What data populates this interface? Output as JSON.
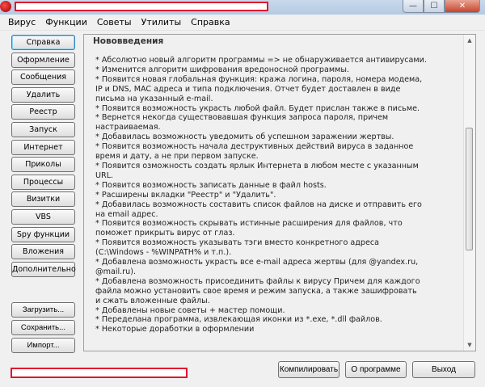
{
  "window": {
    "controls": {
      "minimize": "—",
      "maximize": "☐",
      "close": "✕"
    }
  },
  "menu": [
    "Вирус",
    "Функции",
    "Советы",
    "Утилиты",
    "Справка"
  ],
  "left_buttons": [
    "Справка",
    "Оформление",
    "Сообщения",
    "Удалить",
    "Реестр",
    "Запуск",
    "Интернет",
    "Приколы",
    "Процессы",
    "Визитки",
    "VBS",
    "Spy функции",
    "Вложения",
    "Дополнительно"
  ],
  "left_buttons_bottom": [
    "Загрузить...",
    "Сохранить...",
    "Импорт..."
  ],
  "pane": {
    "title": "Нововведения",
    "lines": [
      "* Абсолютно новый алгоритм программы => не обнаруживается антивирусами.",
      "* Изменится алгоритм шифрования вредоносной программы.",
      "* Появится новая глобальная функция: кража логина, пароля, номера модема,",
      "IP и DNS, MAC адреса и типа подключения.     Отчет будет доставлен в виде",
      "письма на указанный e-mail.",
      "* Появится возможность украсть любой файл. Будет прислан также в письме.",
      "* Вернется некогда существовавшая функция запроса пароля, причем",
      "настраиваемая.",
      "* Добавилась возможность уведомить об успешном заражении жертвы.",
      "* Появится возможность начала деструктивных действий вируса в заданное",
      "время и дату, а не при первом запуске.",
      "* Появится озможность создать ярлык Интернета в любом месте с указанным",
      "URL.",
      "* Появится возможность записать данные в файл hosts.",
      "* Расширены вкладки \"Реестр\" и \"Удалить\".",
      "* Добавилась возможность составить список файлов на диске и отправить его",
      "на email адрес.",
      "* Появится возможность скрывать истинные расширения для файлов, что",
      "поможет прикрыть вирус от глаз.",
      "* Появится возможность указывать тэги вместо конкретного адреса",
      "(C:\\Windows - %WINPATH% и т.п.).",
      "* Добавлена возможность украсть все e-mail адреса жертвы (для @yandex.ru,",
      "@mail.ru).",
      "* Добавлена возможность присоединить файлы к вирусу Причем для каждого",
      "файла можно установить свое время и режим     запуска, а также зашифровать",
      "и сжать вложенные файлы.",
      "* Добавлены новые советы + мастер помощи.",
      "* Переделана программа, извлекающая иконки из *.exe, *.dll файлов.",
      "* Некоторые доработки в оформлении"
    ]
  },
  "bottom_buttons": {
    "compile": "Компилировать",
    "about": "О программе",
    "exit": "Выход"
  }
}
